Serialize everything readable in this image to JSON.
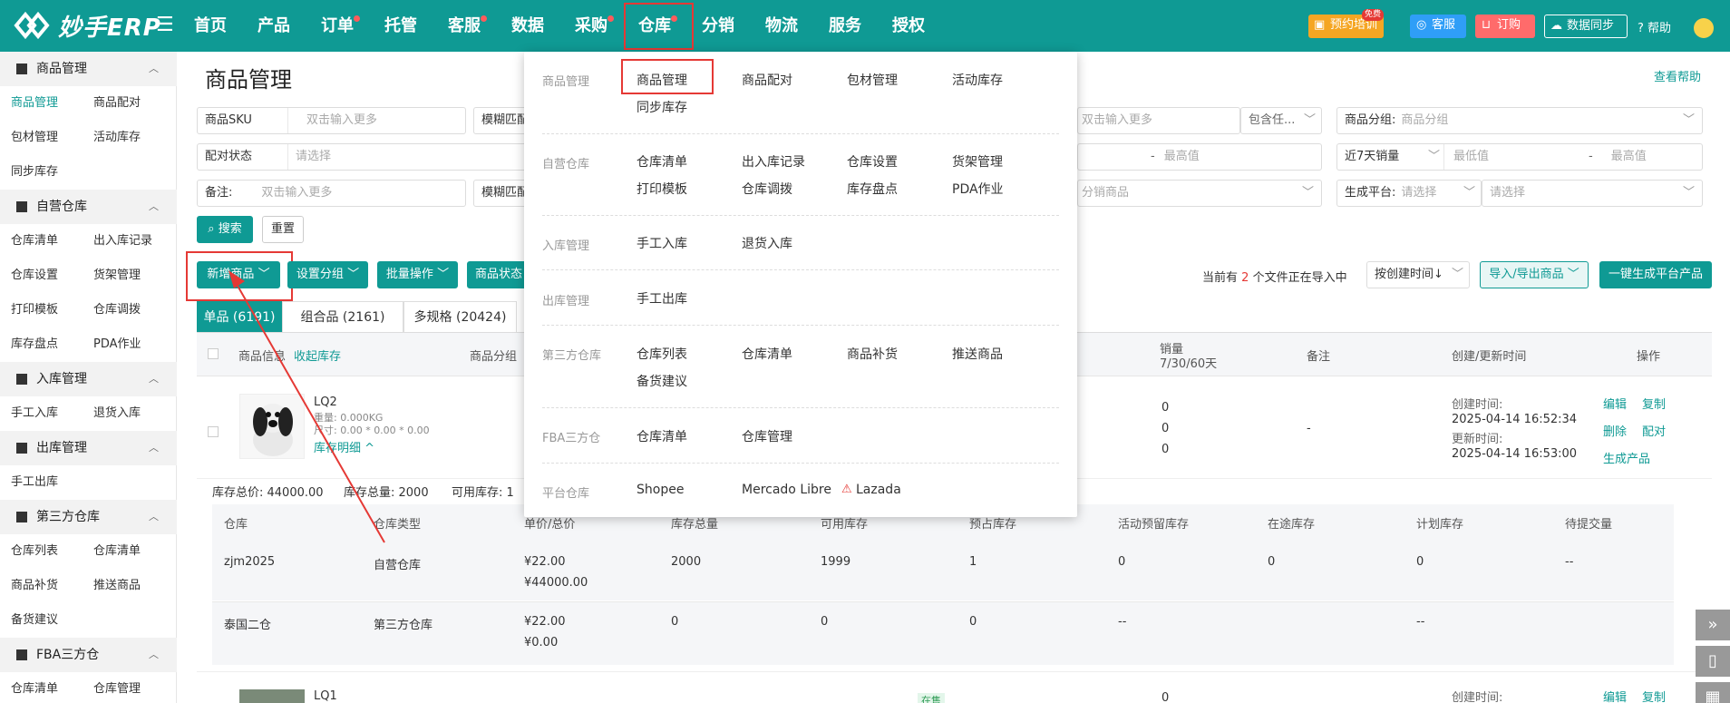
{
  "app": {
    "name": "妙手ERP"
  },
  "nav": {
    "items": [
      "首页",
      "产品",
      "订单",
      "托管",
      "客服",
      "数据",
      "采购",
      "仓库",
      "分销",
      "物流",
      "服务",
      "授权"
    ],
    "active": "仓库"
  },
  "topbar": {
    "training": "预约培训",
    "free_badge": "免费",
    "service": "客服",
    "order": "订购",
    "sync": "数据同步",
    "help": "帮助"
  },
  "sidebar": {
    "groups": [
      {
        "title": "商品管理",
        "items": [
          "商品管理",
          "商品配对",
          "包材管理",
          "活动库存",
          "同步库存"
        ]
      },
      {
        "title": "自营仓库",
        "items": [
          "仓库清单",
          "出入库记录",
          "仓库设置",
          "货架管理",
          "打印模板",
          "仓库调拨",
          "库存盘点",
          "PDA作业"
        ]
      },
      {
        "title": "入库管理",
        "items": [
          "手工入库",
          "退货入库"
        ]
      },
      {
        "title": "出库管理",
        "items": [
          "手工出库"
        ]
      },
      {
        "title": "第三方仓库",
        "items": [
          "仓库列表",
          "仓库清单",
          "商品补货",
          "推送商品",
          "备货建议"
        ]
      },
      {
        "title": "FBA三方仓",
        "items": [
          "仓库清单",
          "仓库管理"
        ]
      }
    ]
  },
  "page": {
    "title": "商品管理",
    "help": "查看帮助"
  },
  "filters": {
    "sku_label": "商品SKU",
    "sku_ph": "双击输入更多",
    "fuzzy": "模糊匹配",
    "dbl_ph": "双击输入更多",
    "include": "包含任...",
    "group_label": "商品分组:",
    "group_ph": "商品分组",
    "pair_label": "配对状态",
    "pair_ph": "请选择",
    "maxval": "最高值",
    "dash": "-",
    "sales_label": "近7天销量",
    "min_ph": "最低值",
    "max_ph": "最高值",
    "note_label": "备注:",
    "note_ph": "双击输入更多",
    "fuzzy2": "模糊匹配",
    "dist_ph": "分销商品",
    "platform_label": "生成平台:",
    "platform_ph": "请选择",
    "select_ph": "请选择",
    "search": "搜索",
    "reset": "重置"
  },
  "actions": {
    "add": "新增商品",
    "group": "设置分组",
    "batch": "批量操作",
    "status": "商品状态",
    "importing_prefix": "当前有",
    "importing_count": "2",
    "importing_suffix": "个文件正在导入中",
    "sort": "按创建时间↓",
    "import_export": "导入/导出商品",
    "generate": "一键生成平台产品"
  },
  "tabs": [
    {
      "label": "单品 (6191)"
    },
    {
      "label": "组合品 (2161)"
    },
    {
      "label": "多规格 (20424)"
    }
  ],
  "table": {
    "headers": {
      "info": "商品信息",
      "collapse": "收起库存",
      "group": "商品分组",
      "sales": "销量",
      "sales_sub": "7/30/60天",
      "note": "备注",
      "time": "创建/更新时间",
      "ops": "操作"
    },
    "rows": [
      {
        "name": "LQ2",
        "weight": "重量: 0.000KG",
        "size": "尺寸: 0.00 * 0.00 * 0.00",
        "detail": "库存明细 ^",
        "sales": [
          "0",
          "0",
          "0"
        ],
        "note": "-",
        "created_label": "创建时间:",
        "created": "2025-04-14 16:52:34",
        "updated_label": "更新时间:",
        "updated": "2025-04-14 16:53:00",
        "ops": [
          "编辑",
          "复制",
          "删除",
          "配对",
          "生成产品"
        ]
      },
      {
        "name": "LQ1",
        "status": "在售",
        "sales": "0",
        "created_label": "创建时间:",
        "ops": [
          "编辑",
          "复制"
        ]
      }
    ],
    "stock_summary": {
      "total_value": "库存总价: 44000.00",
      "total_qty": "库存总量: 2000",
      "available": "可用库存: 1"
    },
    "sub_headers": [
      "仓库",
      "仓库类型",
      "单价/总价",
      "库存总量",
      "可用库存",
      "预占库存",
      "活动预留库存",
      "在途库存",
      "计划库存",
      "待提交量"
    ],
    "sub_rows": [
      [
        "zjm2025",
        "自营仓库",
        "¥22.00",
        "¥44000.00",
        "2000",
        "1999",
        "1",
        "0",
        "0",
        "0",
        "--"
      ],
      [
        "泰国二仓",
        "第三方仓库",
        "¥22.00",
        "¥0.00",
        "0",
        "0",
        "0",
        "--",
        "",
        "--",
        ""
      ]
    ]
  },
  "dropdown": {
    "sections": [
      {
        "cat": "商品管理",
        "items": [
          "商品管理",
          "商品配对",
          "包材管理",
          "活动库存",
          "同步库存"
        ]
      },
      {
        "cat": "自营仓库",
        "items": [
          "仓库清单",
          "出入库记录",
          "仓库设置",
          "货架管理",
          "打印模板",
          "仓库调拨",
          "库存盘点",
          "PDA作业"
        ]
      },
      {
        "cat": "入库管理",
        "items": [
          "手工入库",
          "退货入库"
        ]
      },
      {
        "cat": "出库管理",
        "items": [
          "手工出库"
        ]
      },
      {
        "cat": "第三方仓库",
        "items": [
          "仓库列表",
          "仓库清单",
          "商品补货",
          "推送商品",
          "备货建议"
        ]
      },
      {
        "cat": "FBA三方仓",
        "items": [
          "仓库清单",
          "仓库管理"
        ]
      },
      {
        "cat": "平台仓库",
        "items": [
          "Shopee",
          "Mercado Libre",
          "Lazada"
        ]
      }
    ]
  },
  "colors": {
    "teal": "#0f9a94",
    "red": "#e53935",
    "orange": "#f5a623",
    "blue": "#2f9ef7"
  }
}
